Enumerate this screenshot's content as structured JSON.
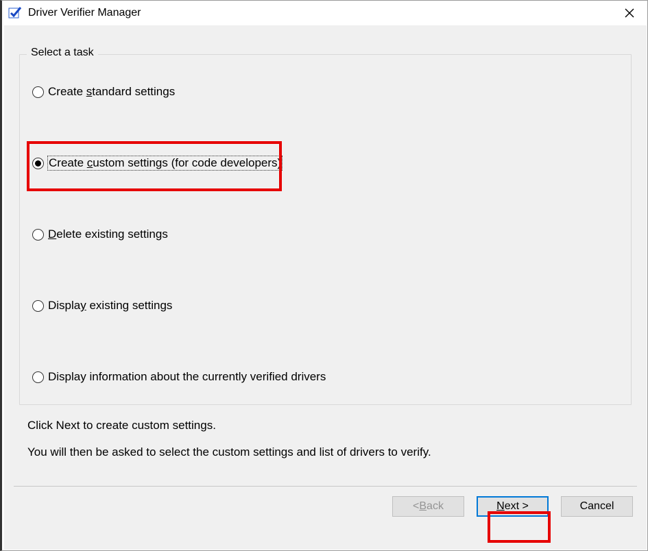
{
  "window": {
    "title": "Driver Verifier Manager",
    "icon": "verifier-checkmark-icon"
  },
  "group": {
    "legend": "Select a task",
    "options": [
      {
        "id": "opt-standard",
        "label_pre": "Create ",
        "label_u": "s",
        "label_post": "tandard settings",
        "selected": false
      },
      {
        "id": "opt-custom",
        "label_pre": "Create ",
        "label_u": "c",
        "label_post": "ustom settings (for code developers)",
        "selected": true
      },
      {
        "id": "opt-delete",
        "label_pre": "",
        "label_u": "D",
        "label_post": "elete existing settings",
        "selected": false
      },
      {
        "id": "opt-display",
        "label_pre": "Displa",
        "label_u": "y",
        "label_post": " existing settings",
        "selected": false
      },
      {
        "id": "opt-info",
        "label_pre": "Display information about the currently verified drivers",
        "label_u": "",
        "label_post": "",
        "selected": false
      }
    ]
  },
  "desc": {
    "line1": "Click Next to create custom settings.",
    "line2": "You will then be asked to select the custom settings and list of drivers to verify."
  },
  "buttons": {
    "back_pre": "< ",
    "back_u": "B",
    "back_post": "ack",
    "next_pre": "",
    "next_u": "N",
    "next_post": "ext >",
    "cancel": "Cancel"
  }
}
